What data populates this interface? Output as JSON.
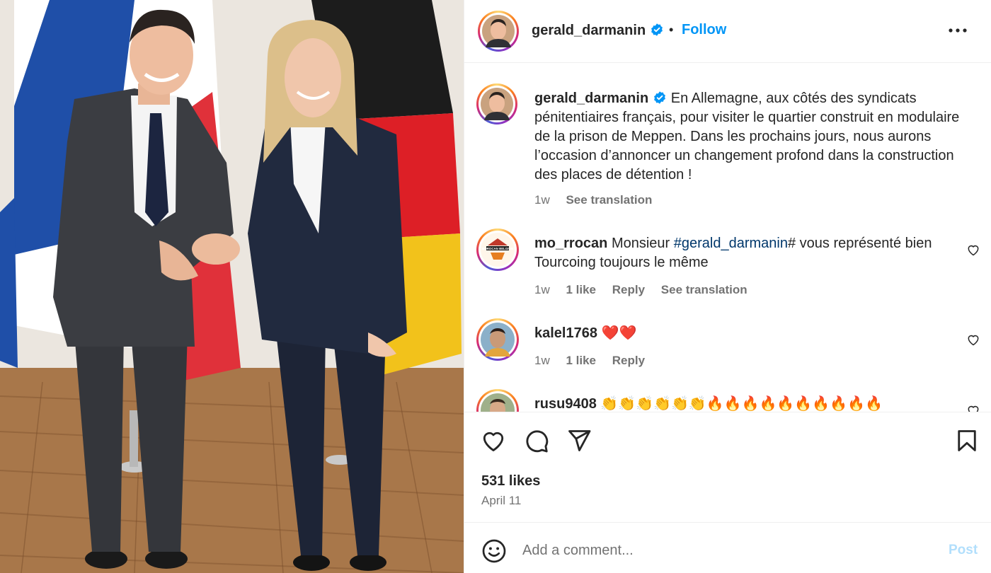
{
  "post": {
    "username": "gerald_darmanin",
    "follow_label": "Follow",
    "separator": "•",
    "caption": "En Allemagne, aux côtés des syndicats pénitentiaires français, pour visiter le quartier construit en modulaire de la prison de Meppen. Dans les prochains jours, nous aurons l’occasion d’annoncer un changement profond dans la construction des places de détention !",
    "caption_time": "1w",
    "see_translation": "See translation",
    "likes": "531 likes",
    "date": "April 11"
  },
  "comments": [
    {
      "username": "mo_rrocan",
      "text_before": "Monsieur ",
      "hashtag": "#gerald_darmanin",
      "text_after": "# vous représenté bien Tourcoing toujours le même",
      "avatar_text": "MOROCAN BELGIUM",
      "time": "1w",
      "likes": "1 like",
      "reply": "Reply",
      "see_translation": "See translation"
    },
    {
      "username": "kalel1768",
      "text": "❤️❤️",
      "time": "1w",
      "likes": "1 like",
      "reply": "Reply"
    },
    {
      "username": "rusu9408",
      "text": "👏👏👏👏👏👏🔥🔥🔥🔥🔥🔥🔥🔥🔥🔥"
    }
  ],
  "add_comment": {
    "placeholder": "Add a comment...",
    "post_label": "Post"
  },
  "colors": {
    "accent": "#0095f6",
    "post_disabled": "#b2dffc",
    "muted": "#737373",
    "hashtag": "#00376b",
    "verified": "#0095f6"
  },
  "icons": [
    "verified-badge-icon",
    "more-options-icon",
    "heart-icon",
    "comment-icon",
    "share-icon",
    "bookmark-icon",
    "emoji-icon"
  ]
}
